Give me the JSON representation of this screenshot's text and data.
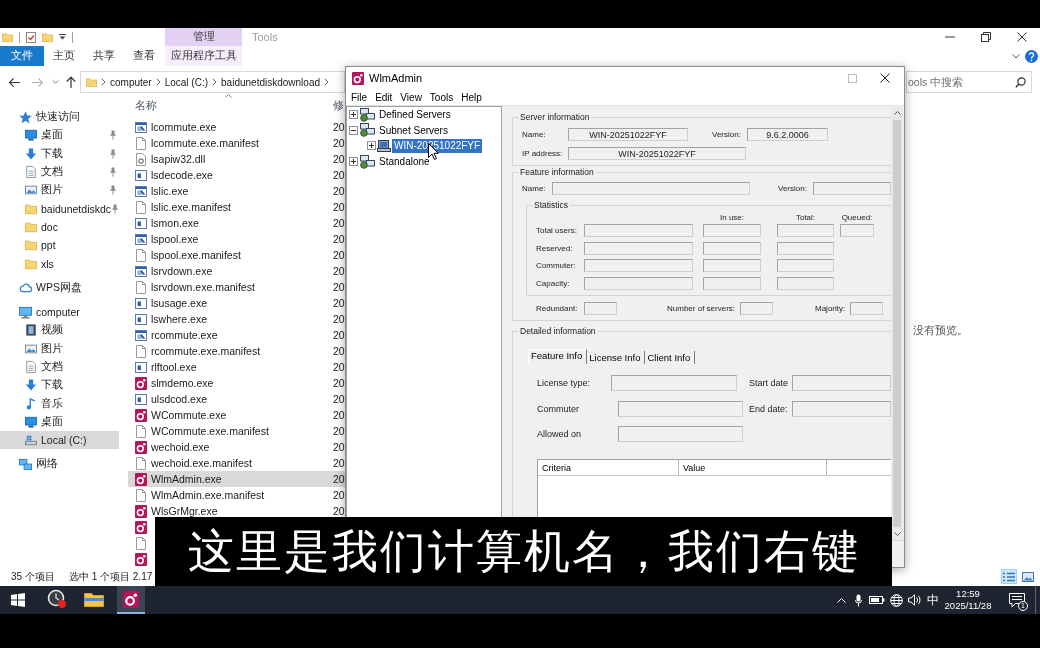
{
  "explorer": {
    "title": "Tools",
    "context_group": "管理",
    "ribbon_tabs": [
      {
        "label": "文件",
        "kind": "file",
        "selected": false
      },
      {
        "label": "主页",
        "kind": "tab",
        "selected": false
      },
      {
        "label": "共享",
        "kind": "tab",
        "selected": false
      },
      {
        "label": "查看",
        "kind": "tab",
        "selected": false
      },
      {
        "label": "应用程序工具",
        "kind": "context",
        "selected": false
      }
    ],
    "address": {
      "segments": [
        "computer",
        "Local (C:)",
        "baidunetdiskdownload"
      ]
    },
    "search": {
      "placeholder": "ools 中搜索"
    },
    "sidebar": [
      {
        "label": "快速访问",
        "kind": "star",
        "pinned": false,
        "selected": false,
        "children": [
          {
            "label": "桌面",
            "kind": "desktop",
            "pinned": true,
            "selected": false
          },
          {
            "label": "下载",
            "kind": "download",
            "pinned": true,
            "selected": false
          },
          {
            "label": "文档",
            "kind": "documents",
            "pinned": true,
            "selected": false
          },
          {
            "label": "图片",
            "kind": "pictures",
            "pinned": true,
            "selected": false
          },
          {
            "label": "baidunetdiskdc",
            "kind": "folder",
            "pinned": true,
            "selected": false
          },
          {
            "label": "doc",
            "kind": "folder",
            "pinned": false,
            "selected": false
          },
          {
            "label": "ppt",
            "kind": "folder",
            "pinned": false,
            "selected": false
          },
          {
            "label": "xls",
            "kind": "folder",
            "pinned": false,
            "selected": false
          }
        ]
      },
      {
        "label": "WPS网盘",
        "kind": "cloud",
        "pinned": false,
        "selected": false
      },
      {
        "label": "computer",
        "kind": "computer",
        "pinned": false,
        "selected": false,
        "children": [
          {
            "label": "视频",
            "kind": "video",
            "pinned": false,
            "selected": false
          },
          {
            "label": "图片",
            "kind": "pictures",
            "pinned": false,
            "selected": false
          },
          {
            "label": "文档",
            "kind": "documents",
            "pinned": false,
            "selected": false
          },
          {
            "label": "下载",
            "kind": "download",
            "pinned": false,
            "selected": false
          },
          {
            "label": "音乐",
            "kind": "music",
            "pinned": false,
            "selected": false
          },
          {
            "label": "桌面",
            "kind": "desktop",
            "pinned": false,
            "selected": false
          },
          {
            "label": "Local (C:)",
            "kind": "drive",
            "pinned": false,
            "selected": true
          }
        ]
      },
      {
        "label": "网络",
        "kind": "network",
        "pinned": false,
        "selected": false
      }
    ],
    "file_list": {
      "columns": [
        "名称",
        "修"
      ],
      "rows": [
        {
          "name": "lcommute.exe",
          "kind": "app",
          "date": "20",
          "selected": false
        },
        {
          "name": "lcommute.exe.manifest",
          "kind": "file",
          "date": "20",
          "selected": false
        },
        {
          "name": "lsapiw32.dll",
          "kind": "dll",
          "date": "20",
          "selected": false
        },
        {
          "name": "lsdecode.exe",
          "kind": "console",
          "date": "20",
          "selected": false
        },
        {
          "name": "lslic.exe",
          "kind": "app",
          "date": "20",
          "selected": false
        },
        {
          "name": "lslic.exe.manifest",
          "kind": "file",
          "date": "20",
          "selected": false
        },
        {
          "name": "lsmon.exe",
          "kind": "console",
          "date": "20",
          "selected": false
        },
        {
          "name": "lspool.exe",
          "kind": "app",
          "date": "20",
          "selected": false
        },
        {
          "name": "lspool.exe.manifest",
          "kind": "file",
          "date": "20",
          "selected": false
        },
        {
          "name": "lsrvdown.exe",
          "kind": "app",
          "date": "20",
          "selected": false
        },
        {
          "name": "lsrvdown.exe.manifest",
          "kind": "file",
          "date": "20",
          "selected": false
        },
        {
          "name": "lsusage.exe",
          "kind": "console",
          "date": "20",
          "selected": false
        },
        {
          "name": "lswhere.exe",
          "kind": "console",
          "date": "20",
          "selected": false
        },
        {
          "name": "rcommute.exe",
          "kind": "app",
          "date": "20",
          "selected": false
        },
        {
          "name": "rcommute.exe.manifest",
          "kind": "file",
          "date": "20",
          "selected": false
        },
        {
          "name": "rlftool.exe",
          "kind": "console",
          "date": "20",
          "selected": false
        },
        {
          "name": "slmdemo.exe",
          "kind": "sentinel",
          "date": "20",
          "selected": false
        },
        {
          "name": "ulsdcod.exe",
          "kind": "console",
          "date": "20",
          "selected": false
        },
        {
          "name": "WCommute.exe",
          "kind": "sentinel",
          "date": "20",
          "selected": false
        },
        {
          "name": "WCommute.exe.manifest",
          "kind": "file",
          "date": "20",
          "selected": false
        },
        {
          "name": "wechoid.exe",
          "kind": "sentinel",
          "date": "20",
          "selected": false
        },
        {
          "name": "wechoid.exe.manifest",
          "kind": "file",
          "date": "20",
          "selected": false
        },
        {
          "name": "WlmAdmin.exe",
          "kind": "sentinel",
          "date": "20",
          "selected": true
        },
        {
          "name": "WlmAdmin.exe.manifest",
          "kind": "file",
          "date": "20",
          "selected": false
        },
        {
          "name": "WlsGrMgr.exe",
          "kind": "sentinel",
          "date": "20",
          "selected": false
        },
        {
          "kind": "sentinel",
          "selected": false
        },
        {
          "kind": "file",
          "selected": false
        },
        {
          "kind": "sentinel",
          "selected": false
        }
      ]
    },
    "preview": "没有预览。",
    "status_bar": {
      "item_count": "35 个项目",
      "selection": "选中 1 个项目 2.17"
    },
    "view_buttons": [
      {
        "kind": "details",
        "selected": true
      },
      {
        "kind": "large_icons",
        "selected": false
      }
    ]
  },
  "wlmadmin": {
    "title": "WlmAdmin",
    "menu": [
      "File",
      "Edit",
      "View",
      "Tools",
      "Help"
    ],
    "tree": [
      {
        "label": "Defined Servers",
        "kind": "group",
        "expanded": false,
        "selected": false
      },
      {
        "label": "Subnet Servers",
        "kind": "group",
        "expanded": true,
        "selected": false,
        "children": [
          {
            "label": "WIN-20251022FYF",
            "kind": "computer",
            "expanded": false,
            "selected": true
          }
        ]
      },
      {
        "label": "Standalone",
        "kind": "group",
        "expanded": false,
        "selected": false
      }
    ],
    "server_information": {
      "title": "Server information",
      "fields": [
        {
          "label": "Name:",
          "value": "WIN-20251022FYF"
        },
        {
          "label": "Version:",
          "value": "9.6.2.0006"
        },
        {
          "label": "IP address:",
          "value": "WIN-20251022FYF"
        }
      ]
    },
    "feature_information": {
      "title": "Feature information",
      "fields": [
        {
          "label": "Name:"
        },
        {
          "label": "Version:"
        }
      ],
      "statistics": {
        "title": "Statistics",
        "columns": [
          "In use:",
          "Total:",
          "Queued:"
        ],
        "rows": [
          {
            "label": "Total users:",
            "kind": "queued"
          },
          {
            "label": "Reserved:",
            "kind": "plain"
          },
          {
            "label": "Commuter:",
            "kind": "plain"
          },
          {
            "label": "Capacity:",
            "kind": "plain"
          }
        ]
      },
      "summary_fields": [
        {
          "label": "Redundant:"
        },
        {
          "label": "Number of servers:"
        },
        {
          "label": "Majority:"
        }
      ]
    },
    "detailed_information": {
      "title": "Detailed information",
      "tabs": [
        {
          "label": "Feature Info",
          "selected": true
        },
        {
          "label": "License Info",
          "selected": false
        },
        {
          "label": "Client Info",
          "selected": false
        }
      ],
      "fields": [
        {
          "label": "License type:"
        },
        {
          "label": "Start date"
        },
        {
          "label": "Commuter"
        },
        {
          "label": "End date:"
        },
        {
          "label": "Allowed on"
        }
      ],
      "table": {
        "columns": [
          "Criteria",
          "Value"
        ]
      }
    }
  },
  "subtitle": "这里是我们计算机名，我们右键",
  "taskbar": {
    "apps": [
      {
        "kind": "recorder",
        "active": false
      },
      {
        "kind": "explorer",
        "active": false
      },
      {
        "kind": "sentinel",
        "active": true
      }
    ],
    "input_method": "中",
    "time": "12:59",
    "date": "2025/11/28",
    "notifications": "1"
  }
}
